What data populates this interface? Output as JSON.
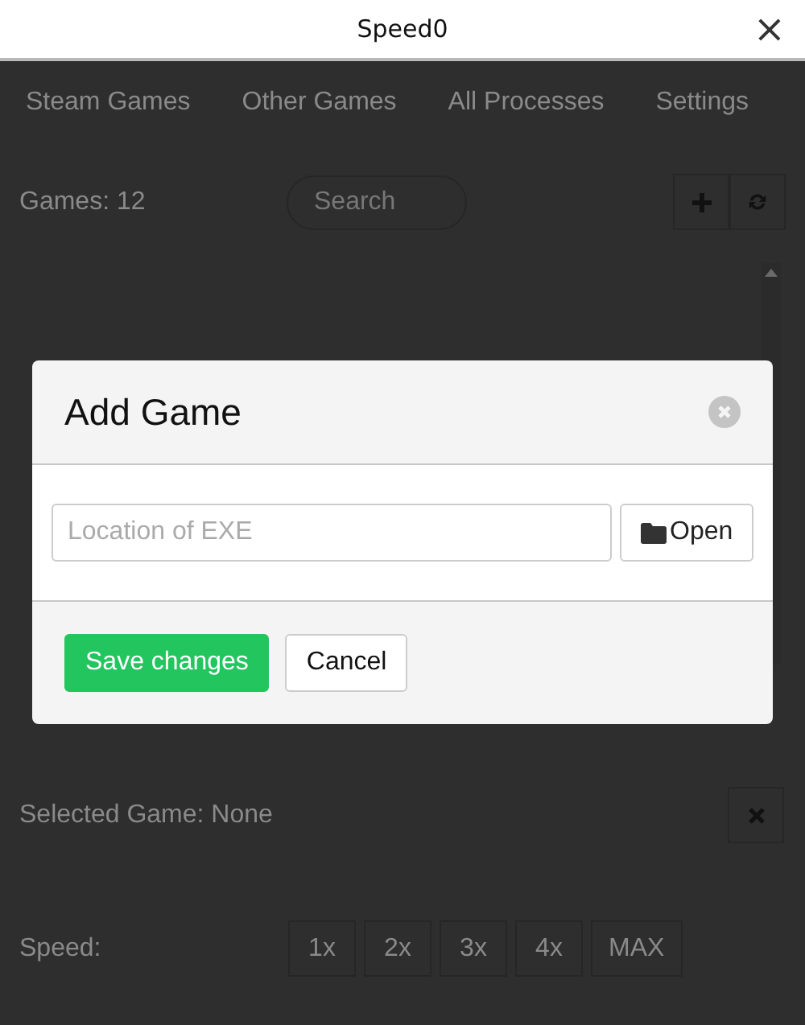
{
  "window": {
    "title": "Speed0",
    "close": "×"
  },
  "tabs": [
    {
      "label": "Steam Games"
    },
    {
      "label": "Other Games"
    },
    {
      "label": "All Processes"
    },
    {
      "label": "Settings"
    }
  ],
  "games_count": "Games: 12",
  "search": {
    "placeholder": "Search"
  },
  "selected_game": "Selected Game: None",
  "speed": {
    "label": "Speed:",
    "options": [
      "1x",
      "2x",
      "3x",
      "4x",
      "MAX"
    ]
  },
  "dialog": {
    "title": "Add Game",
    "field": {
      "placeholder": "Location of EXE"
    },
    "open_button": "Open",
    "buttons": [
      {
        "label": "Save changes",
        "kind": "primary"
      },
      {
        "label": "Cancel",
        "kind": "default"
      }
    ]
  }
}
